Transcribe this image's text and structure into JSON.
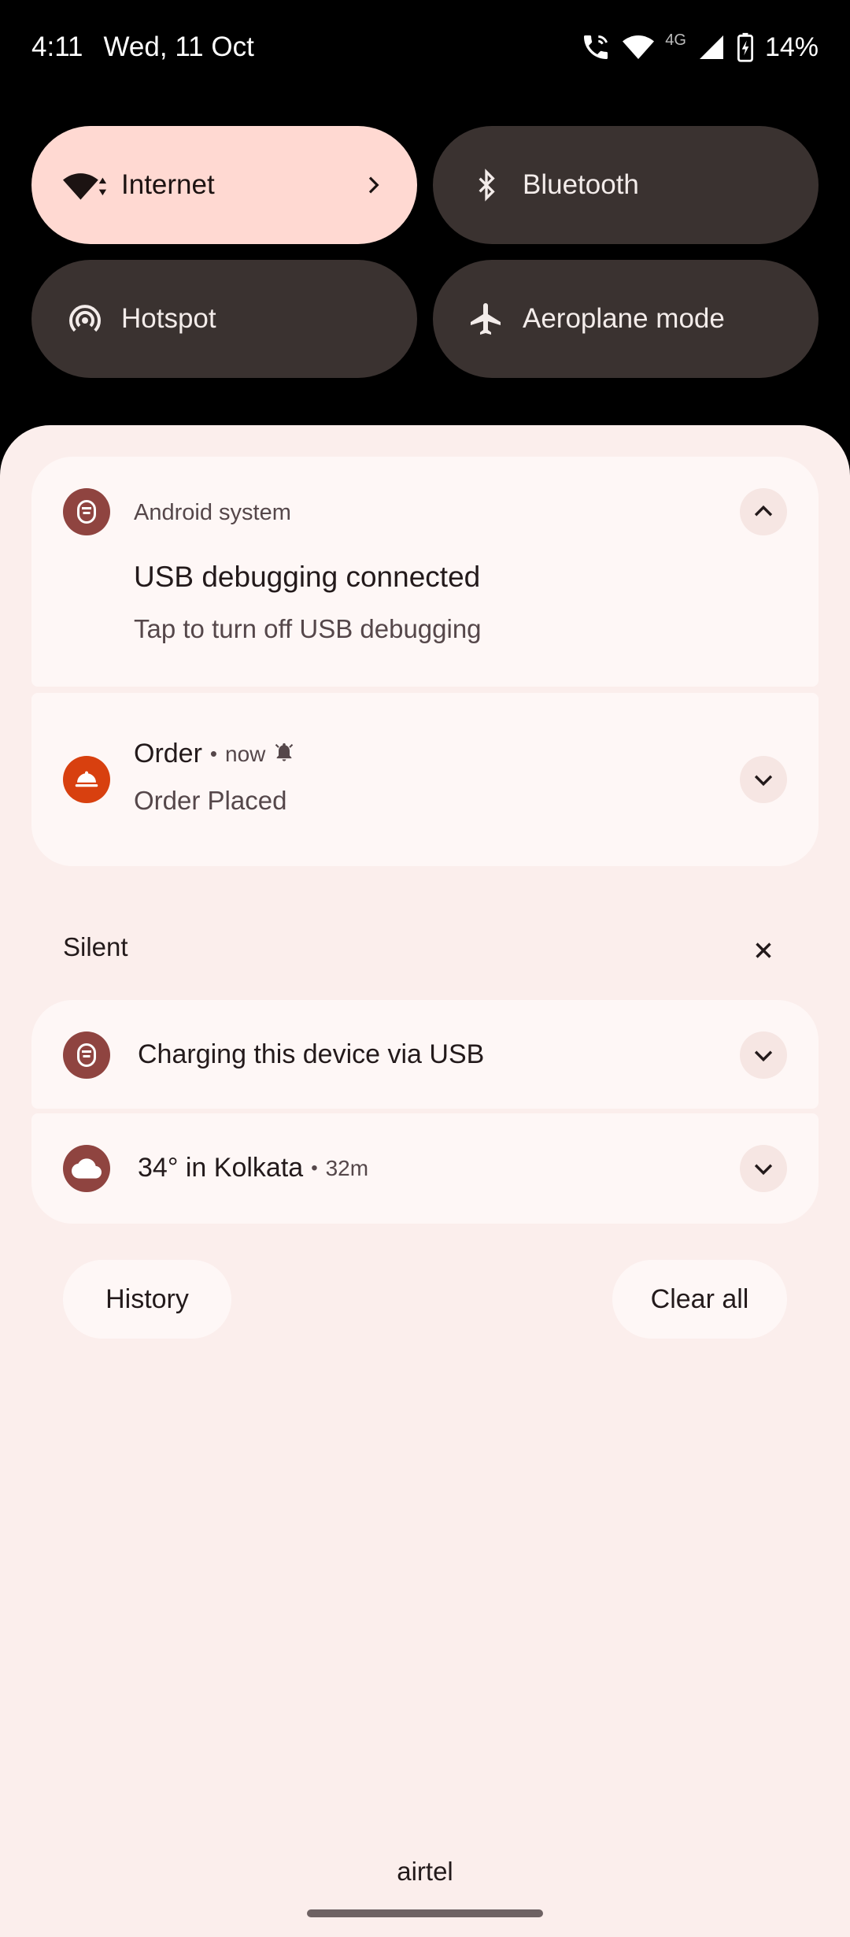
{
  "status_bar": {
    "time": "4:11",
    "date": "Wed, 11 Oct",
    "network_type": "4G",
    "battery": "14%",
    "icons": [
      "wifi-call-icon",
      "wifi-icon",
      "signal-icon",
      "battery-charging-icon"
    ]
  },
  "quick_settings": {
    "tiles": [
      {
        "label": "Internet",
        "icon": "wifi-icon",
        "active": true
      },
      {
        "label": "Bluetooth",
        "icon": "bluetooth-icon",
        "active": false
      },
      {
        "label": "Hotspot",
        "icon": "hotspot-icon",
        "active": false
      },
      {
        "label": "Aeroplane mode",
        "icon": "airplane-icon",
        "active": false
      }
    ]
  },
  "notifications": [
    {
      "app": "Android system",
      "title": "USB debugging connected",
      "text": "Tap to turn off USB debugging",
      "icon": "android-system-icon",
      "expanded": true
    },
    {
      "title": "Order",
      "time": "now",
      "text": "Order Placed",
      "icon": "food-service-icon",
      "alert_icon": "bell-icon",
      "expanded": false
    }
  ],
  "silent_section": {
    "header": "Silent",
    "items": [
      {
        "title": "Charging this device via USB",
        "icon": "android-system-icon"
      },
      {
        "title": "34° in Kolkata",
        "time": "32m",
        "icon": "cloud-icon"
      }
    ]
  },
  "footer": {
    "history_label": "History",
    "clear_all_label": "Clear all",
    "carrier": "airtel"
  },
  "colors": {
    "active_tile": "#ffd9d2",
    "inactive_tile": "#3a3230",
    "shade_bg": "#fbeeec",
    "card_bg": "#fef7f6",
    "app_icon_maroon": "#8f4440",
    "app_icon_orange": "#d8400f"
  }
}
